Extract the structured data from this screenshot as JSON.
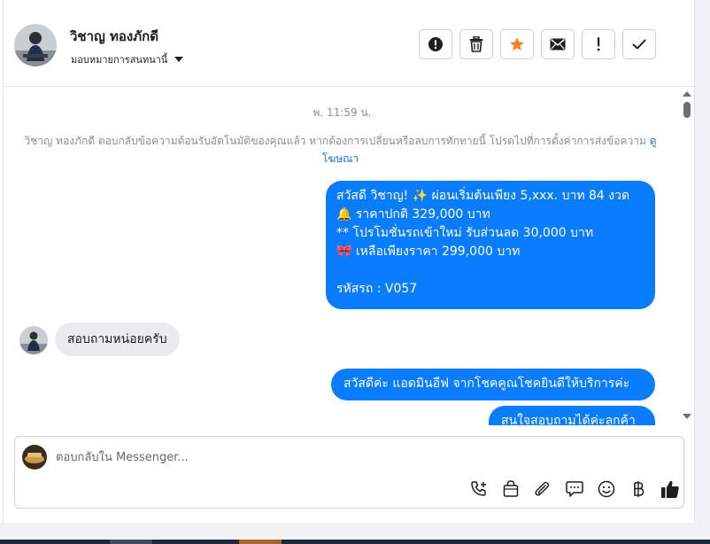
{
  "header": {
    "contact_name": "วิชาญ ทองภักดี",
    "assign_label": "มอบหมายการสนทนานี้",
    "actions": [
      {
        "icon": "alert-circle-icon",
        "label": "report"
      },
      {
        "icon": "trash-icon",
        "label": "delete"
      },
      {
        "icon": "star-icon",
        "label": "star"
      },
      {
        "icon": "envelope-icon",
        "label": "mark-unread"
      },
      {
        "icon": "exclamation-icon",
        "label": "spam"
      },
      {
        "icon": "check-icon",
        "label": "done"
      }
    ]
  },
  "conversation": {
    "timestamp": "พ. 11:59 น.",
    "system_note": "วิชาญ ทองภักดี ตอบกลับข้อความต้อนรับอัตโนมัติของคุณแล้ว หากต้องการเปลี่ยนหรือลบการทักทายนี้ โปรดไปที่การตั้งค่าการส่งข้อความ",
    "system_note_link": "ดูโฆษณา",
    "messages": [
      {
        "direction": "outgoing",
        "lines": [
          "สวัสดี วิชาญ! ✨  ผ่อนเริ่มต้นเพียง 5,xxx. บาท 84 งวด",
          "🔔 ราคาปกติ 329,000 บาท",
          "** โปรโมชั่นรถเข้าใหม่ รับส่วนลด 30,000 บาท",
          "🎀  เหลือเพียงราคา 299,000 บาท",
          "",
          " รหัสรถ : V057"
        ]
      },
      {
        "direction": "incoming",
        "text": "สอบถามหน่อยครับ"
      },
      {
        "direction": "outgoing",
        "text": "สวัสดีค่ะ แอดมินอีฟ จากโชคคูณโชคยินดีให้บริการค่ะ"
      },
      {
        "direction": "outgoing",
        "text": "สนใจสอบถามได้ค่ะลูกค้า"
      }
    ]
  },
  "composer": {
    "placeholder": "ตอบกลับใน Messenger...",
    "tools": [
      "phone-plus-icon",
      "shopping-bag-icon",
      "paperclip-icon",
      "saved-reply-icon",
      "emoji-icon",
      "baht-icon",
      "thumbs-up-icon"
    ]
  },
  "colors": {
    "outgoing_bubble": "#0a7cff",
    "incoming_bubble": "#e9ebee",
    "star": "#f5821f",
    "link": "#216fdb"
  }
}
